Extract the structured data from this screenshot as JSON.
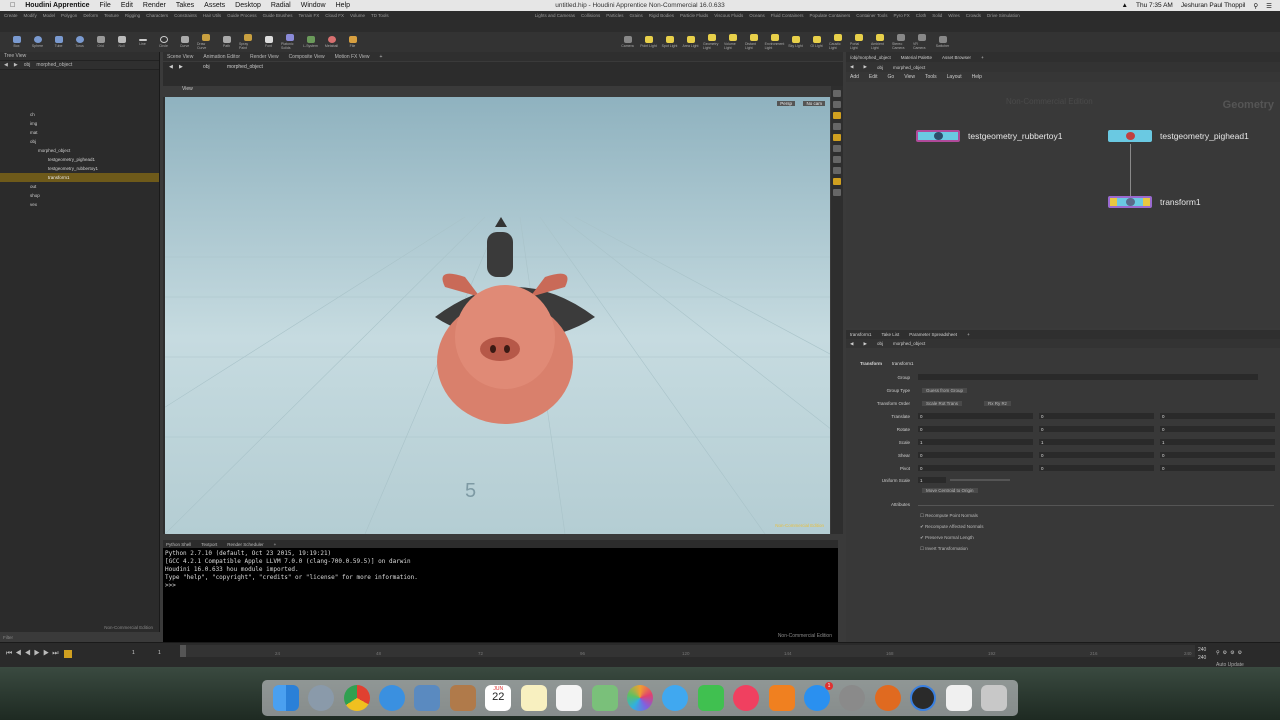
{
  "menubar": {
    "app": "Houdini Apprentice",
    "items": [
      "File",
      "Edit",
      "Render",
      "Takes",
      "Assets",
      "Desktop",
      "Radial",
      "Window",
      "Help"
    ],
    "title": "untitled.hip - Houdini Apprentice Non-Commercial 16.0.633",
    "clock": "Thu 7:35 AM",
    "user": "Jeshuran Paul Thoppil"
  },
  "shelf": {
    "tabs_left": [
      "Create",
      "Modify",
      "Model",
      "Polygon",
      "Deform",
      "Texture",
      "Rigging",
      "Characters",
      "Constraints",
      "Hair Utils",
      "Guide Process",
      "Guide Brushes",
      "Terrain FX",
      "Cloud FX",
      "Volume",
      "TD Tools"
    ],
    "tabs_right": [
      "Lights and Cameras",
      "Collisions",
      "Particles",
      "Grains",
      "Rigid Bodies",
      "Particle Fluids",
      "Viscous Fluids",
      "Oceans",
      "Fluid Containers",
      "Populate Containers",
      "Container Tools",
      "Pyro FX",
      "Cloth",
      "Solid",
      "Wires",
      "Crowds",
      "Drive Simulation"
    ],
    "tools_left": [
      "Box",
      "Sphere",
      "Tube",
      "Torus",
      "Grid",
      "Null",
      "Line",
      "Circle",
      "Curve",
      "Draw Curve",
      "Path",
      "Spray Paint",
      "Font",
      "Platonic Solids",
      "L-System",
      "Metaball",
      "File"
    ],
    "tools_right": [
      "Camera",
      "Point Light",
      "Spot Light",
      "Area Light",
      "Geometry Light",
      "Volume Light",
      "Distant Light",
      "Environment Light",
      "Sky Light",
      "GI Light",
      "Caustic Light",
      "Portal Light",
      "Ambient Light",
      "Stereo Camera",
      "VR Camera",
      "Switcher"
    ]
  },
  "tree": {
    "header": "Tree View",
    "path": "obj",
    "context": "morphed_object",
    "items": [
      {
        "label": "ch",
        "selected": false
      },
      {
        "label": "img",
        "selected": false
      },
      {
        "label": "mat",
        "selected": false
      },
      {
        "label": "obj",
        "selected": false
      },
      {
        "label": "morphed_object",
        "selected": false
      },
      {
        "label": "testgeometry_pighead1",
        "selected": false
      },
      {
        "label": "testgeometry_rubbertoy1",
        "selected": false
      },
      {
        "label": "transform1",
        "selected": true
      },
      {
        "label": "out",
        "selected": false
      },
      {
        "label": "shop",
        "selected": false
      },
      {
        "label": "vex",
        "selected": false
      }
    ],
    "watermark": "Non-Commercial Edition",
    "filter": "Filter"
  },
  "viewport": {
    "tabs": [
      "Scene View",
      "Animation Editor",
      "Render View",
      "Composite View",
      "Motion FX View"
    ],
    "path": "obj",
    "context": "morphed_object",
    "label": "View",
    "camera": "Persp",
    "cam_menu": "No cam",
    "grid_number": "5",
    "watermark": "Non-Commercial Edition"
  },
  "console": {
    "tabs": [
      "Python Shell",
      "Textport",
      "Render Scheduler"
    ],
    "lines": [
      "Python 2.7.10 (default, Oct 23 2015, 19:19:21)",
      "[GCC 4.2.1 Compatible Apple LLVM 7.0.0 (clang-700.0.59.5)] on darwin",
      "Houdini 16.0.633 hou module imported.",
      "Type \"help\", \"copyright\", \"credits\" or \"license\" for more information.",
      ">>>"
    ],
    "watermark": "Non-Commercial Edition"
  },
  "network": {
    "tabs": [
      "/obj/morphed_object",
      "Material Palette",
      "Asset Browser"
    ],
    "path": "obj",
    "context": "morphed_object",
    "menu": [
      "Add",
      "Edit",
      "Go",
      "View",
      "Tools",
      "Layout",
      "Help"
    ],
    "watermark": "Non-Commercial Edition",
    "type_label": "Geometry",
    "nodes": [
      "testgeometry_rubbertoy1",
      "testgeometry_pighead1",
      "transform1"
    ]
  },
  "parms": {
    "tabs": [
      "transform1",
      "Take List",
      "Parameter Spreadsheet"
    ],
    "path": "obj",
    "context": "morphed_object",
    "node_type": "Transform",
    "node_name": "transform1",
    "group_label": "Group",
    "group_type_label": "Group Type",
    "group_type_value": "Guess from Group",
    "order_label": "Transform Order",
    "order_value": "Scale Rot Trans",
    "rot_order_value": "Rx Ry Rz",
    "rows": [
      {
        "label": "Translate",
        "v": [
          "0",
          "0",
          "0"
        ]
      },
      {
        "label": "Rotate",
        "v": [
          "0",
          "0",
          "0"
        ]
      },
      {
        "label": "Scale",
        "v": [
          "1",
          "1",
          "1"
        ]
      },
      {
        "label": "Shear",
        "v": [
          "0",
          "0",
          "0"
        ]
      },
      {
        "label": "Pivot",
        "v": [
          "0",
          "0",
          "0"
        ]
      }
    ],
    "uniform_label": "Uniform Scale",
    "uniform_value": "1",
    "centroid_button": "Move Centroid to Origin",
    "attributes_label": "Attributes",
    "checks": [
      {
        "label": "Recompute Point Normals",
        "checked": false
      },
      {
        "label": "Recompute Affected Normals",
        "checked": true
      },
      {
        "label": "Preserve Normal Length",
        "checked": true
      },
      {
        "label": "Invert Transformation",
        "checked": false
      }
    ]
  },
  "timeline": {
    "current_frame": "1",
    "start": "1",
    "ticks": [
      "24",
      "48",
      "72",
      "96",
      "120",
      "144",
      "168",
      "192",
      "216",
      "240"
    ],
    "end": "240",
    "end2": "240",
    "auto_update": "Auto Update"
  },
  "dock": {
    "apps": [
      "Finder",
      "Launchpad",
      "Chrome",
      "Safari",
      "Preview",
      "Notes-brown",
      "Calendar",
      "Notes",
      "Reminders",
      "Maps",
      "Photos",
      "Messages",
      "FaceTime",
      "iTunes",
      "iBooks",
      "App Store",
      "System Preferences",
      "Houdini",
      "Houdini FX",
      "Document",
      "Trash"
    ],
    "calendar_day": "22",
    "calendar_month": "JUN",
    "appstore_badge": "1"
  }
}
